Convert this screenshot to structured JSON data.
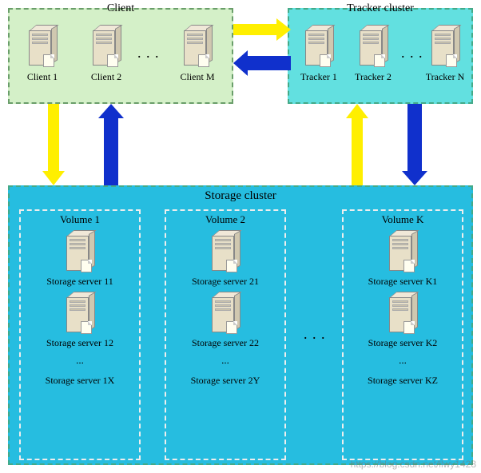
{
  "clusters": {
    "client": {
      "title": "Client",
      "nodes": [
        "Client 1",
        "Client 2",
        "Client M"
      ],
      "ellipsis": ". . ."
    },
    "tracker": {
      "title": "Tracker cluster",
      "nodes": [
        "Tracker 1",
        "Tracker 2",
        "Tracker N"
      ],
      "ellipsis": ". . ."
    },
    "storage": {
      "title": "Storage cluster",
      "ellipsis": ". . .",
      "volumes": [
        {
          "title": "Volume 1",
          "servers": [
            "Storage server 11",
            "Storage server 12"
          ],
          "more": "...",
          "last": "Storage server 1X"
        },
        {
          "title": "Volume 2",
          "servers": [
            "Storage server 21",
            "Storage server 22"
          ],
          "more": "...",
          "last": "Storage server 2Y"
        },
        {
          "title": "Volume K",
          "servers": [
            "Storage server K1",
            "Storage server K2"
          ],
          "more": "...",
          "last": "Storage server KZ"
        }
      ]
    }
  },
  "arrows": {
    "client_to_tracker": "yellow-right",
    "tracker_to_client": "blue-left",
    "client_to_storage": "yellow-down",
    "storage_to_client": "blue-up",
    "storage_to_tracker": "yellow-up",
    "tracker_to_storage": "blue-down"
  },
  "watermark": "https://blog.csdn.net/llwy1428"
}
